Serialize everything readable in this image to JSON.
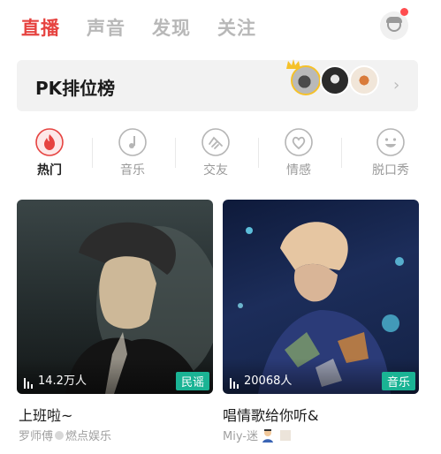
{
  "top_tabs": [
    "直播",
    "声音",
    "发现",
    "关注"
  ],
  "pk": {
    "title": "PK排位榜",
    "arrow": "›"
  },
  "categories": [
    "热门",
    "音乐",
    "交友",
    "情感",
    "脱口秀"
  ],
  "cards": [
    {
      "listeners": "14.2万人",
      "tag": "民谣",
      "title": "上班啦~",
      "host": "罗师傅",
      "host_suffix": "燃点娱乐"
    },
    {
      "listeners": "20068人",
      "tag": "音乐",
      "title": "唱情歌给你听&",
      "host": "Miy-迷",
      "host_suffix": ""
    }
  ],
  "colors": {
    "accent": "#e64340",
    "tag": "#1ab394",
    "inactive": "#b8b8b8"
  }
}
